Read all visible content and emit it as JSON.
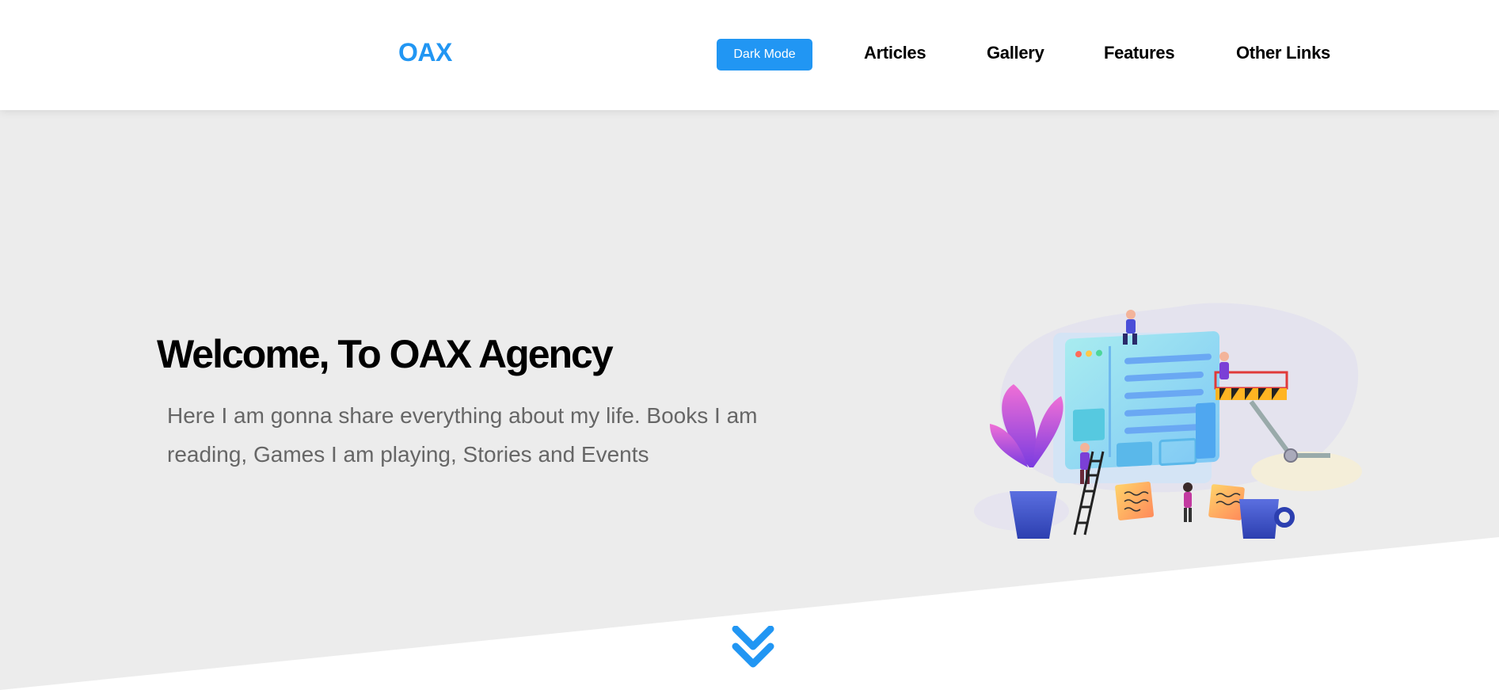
{
  "header": {
    "logo": "OAX",
    "dark_mode_label": "Dark Mode",
    "nav": [
      {
        "label": "Articles"
      },
      {
        "label": "Gallery"
      },
      {
        "label": "Features"
      },
      {
        "label": "Other Links"
      }
    ]
  },
  "hero": {
    "title": "Welcome, To OAX Agency",
    "text": "Here I am gonna share everything about my life. Books I am reading, Games I am playing, Stories and Events",
    "illustration_icon": "website-building-illustration",
    "scroll_icon": "chevron-double-down-icon"
  },
  "colors": {
    "accent": "#2196f3",
    "hero_bg": "#ececec",
    "text_muted": "#666666"
  }
}
